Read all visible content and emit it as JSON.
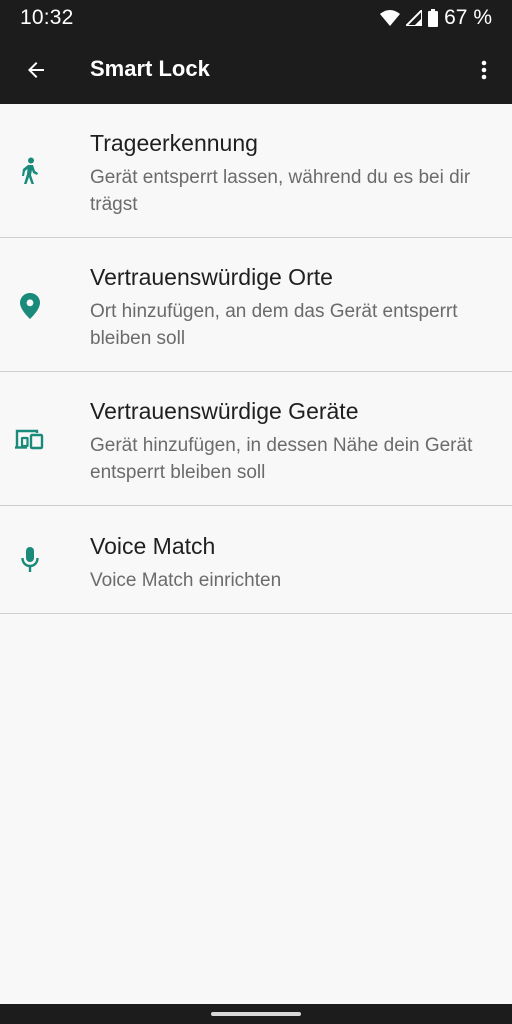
{
  "status_bar": {
    "time": "10:32",
    "battery_text": "67 %",
    "icons": [
      "wifi-icon",
      "signal-icon",
      "battery-icon"
    ]
  },
  "app_bar": {
    "title": "Smart Lock",
    "back_icon": "arrow-back-icon",
    "overflow_icon": "more-vert-icon"
  },
  "accent_color": "#1a8a7a",
  "items": [
    {
      "icon": "walking-person-icon",
      "title": "Trageerkennung",
      "summary": "Gerät entsperrt lassen, während du es bei dir trägst"
    },
    {
      "icon": "location-pin-icon",
      "title": "Vertrauenswürdige Orte",
      "summary": "Ort hinzufügen, an dem das Gerät entsperrt bleiben soll"
    },
    {
      "icon": "devices-icon",
      "title": "Vertrauenswürdige Geräte",
      "summary": "Gerät hinzufügen, in dessen Nähe dein Gerät entsperrt bleiben soll"
    },
    {
      "icon": "microphone-icon",
      "title": "Voice Match",
      "summary": "Voice Match einrichten"
    }
  ]
}
